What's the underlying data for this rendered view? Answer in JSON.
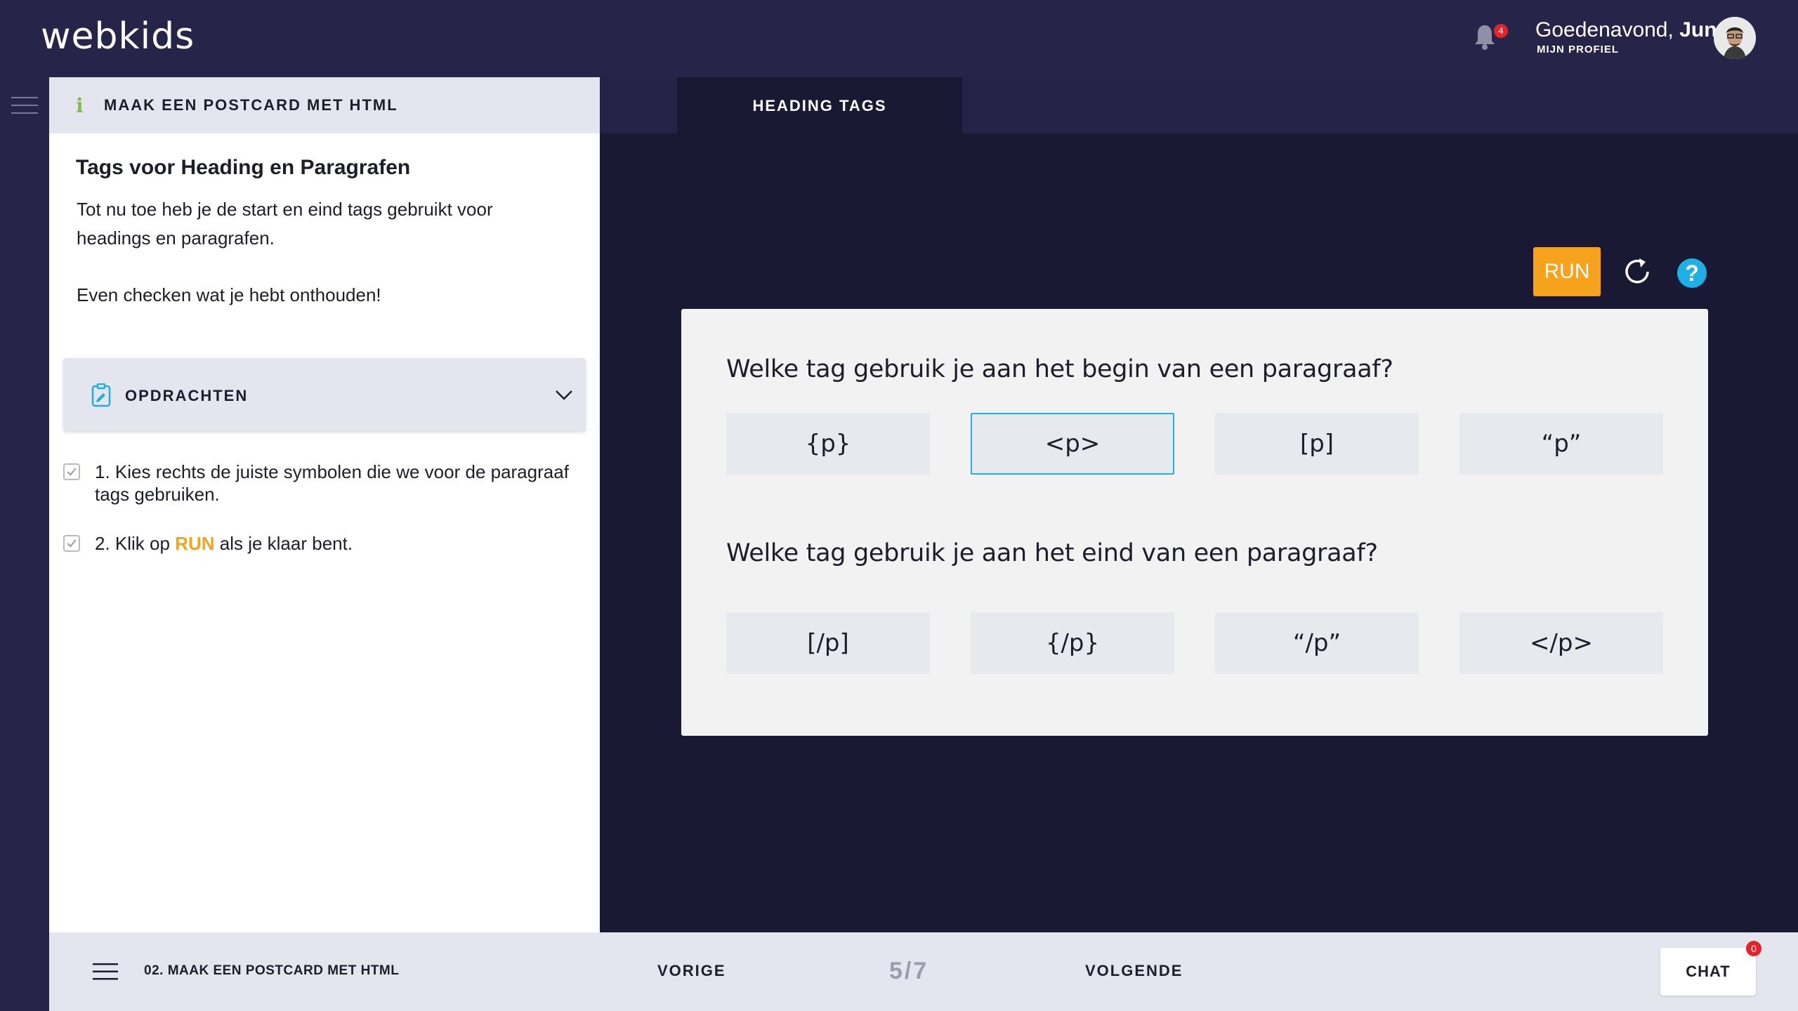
{
  "header": {
    "logo": "webkids",
    "notifications_count": "4",
    "greeting": "Goedenavond,",
    "user_name": "Jun",
    "profile_link": "MIJN PROFIEL"
  },
  "lesson_panel": {
    "header_title": "MAAK EEN POSTCARD MET HTML",
    "title": "Tags voor Heading en Paragrafen",
    "paragraph_1": "Tot nu toe heb je de start en eind tags gebruikt voor headings en paragrafen.",
    "paragraph_2": "Even checken wat je hebt onthouden!",
    "assignments_label": "OPDRACHTEN",
    "tasks": [
      {
        "text": "1. Kies rechts de juiste symbolen die we voor de paragraaf tags gebruiken.",
        "checked": true
      },
      {
        "prefix": "2. Klik op ",
        "highlight": "RUN",
        "suffix": " als je klaar bent.",
        "checked": true
      }
    ]
  },
  "editor": {
    "tab_label": "HEADING TAGS",
    "run_label": "RUN",
    "help_label": "?",
    "questions": [
      {
        "text": "Welke tag gebruik je aan het begin van een paragraaf?",
        "options": [
          "{p}",
          "<p>",
          "[p]",
          "“p”"
        ],
        "selected_index": 1
      },
      {
        "text": "Welke tag gebruik je aan het eind van een paragraaf?",
        "options": [
          "[/p]",
          "{/p}",
          "“/p”",
          "</p>"
        ],
        "selected_index": null
      }
    ]
  },
  "footer": {
    "course_label": "02. MAAK EEN POSTCARD MET HTML",
    "prev_label": "VORIGE",
    "page_indicator": "5/7",
    "next_label": "VOLGENDE",
    "chat_label": "CHAT",
    "chat_badge": "0"
  },
  "colors": {
    "topbar": "#262549",
    "editor_bg": "#1a1934",
    "accent_orange": "#f6a21d",
    "accent_blue": "#1eb0e5",
    "badge_red": "#e4232b",
    "info_green": "#7cc242"
  }
}
